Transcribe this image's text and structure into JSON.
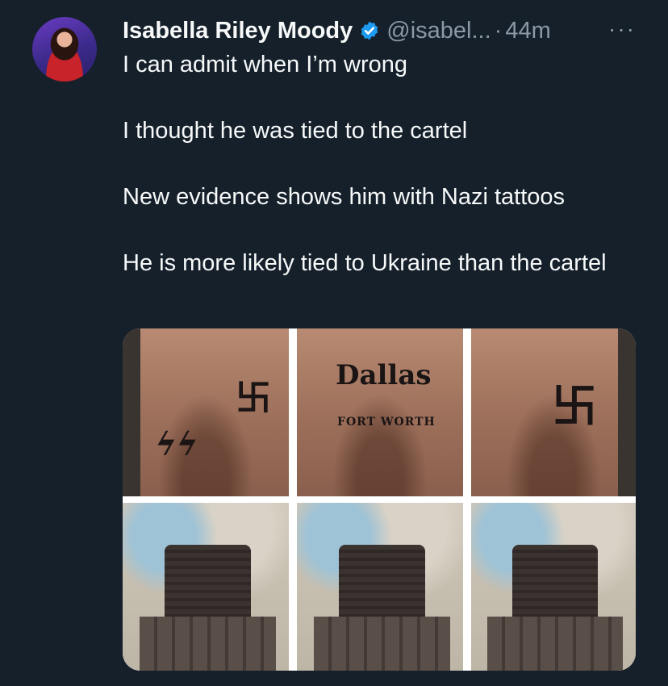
{
  "author": {
    "display_name": "Isabella Riley Moody",
    "handle": "@isabel...",
    "separator": "·",
    "time_ago": "44m",
    "verified": true
  },
  "more_icon_label": "···",
  "tweet": {
    "lines": [
      "I can admit when I’m wrong",
      "I thought he was tied to the cartel",
      "New evidence shows him with Nazi tattoos",
      "He is more likely tied to Ukraine than the cartel"
    ]
  },
  "media": {
    "photos": [
      {
        "tattoo_text": "卐"
      },
      {
        "tattoo_text_1": "Dallas",
        "tattoo_text_2": "FORT WORTH"
      },
      {
        "tattoo_text": "卐"
      }
    ]
  },
  "colors": {
    "background": "#15202b",
    "text_primary": "#f7f9f9",
    "text_secondary": "#8b98a5",
    "verified_blue": "#1d9bf0"
  }
}
